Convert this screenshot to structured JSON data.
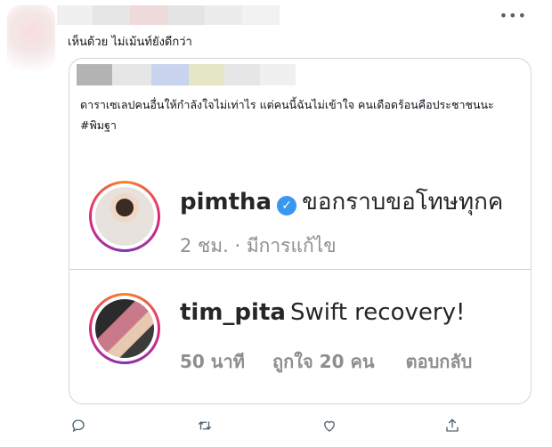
{
  "tweet": {
    "text": "เห็นด้วย ไม่เม้นท์ยังดีกว่า",
    "more_icon": "more-horizontal-icon",
    "redaction_colors": [
      "#f0f0f0",
      "#e6e6e6",
      "#eedada",
      "#e4e4e4",
      "#ececec",
      "#f2f2f2"
    ]
  },
  "quote": {
    "text": "ดาราเซเลปคนอื่นให้กำลังใจไม่เท่าไร แต่คนนี้ฉันไม่เข้าใจ คนเดือดร้อนคือประชาชนนะ #พิมฐา",
    "redaction_colors": [
      "#b3b3b3",
      "#e6e6e6",
      "#c8d4ee",
      "#e4e6c4",
      "#e6e6e6",
      "#f0f0f0"
    ]
  },
  "instagram": {
    "post": {
      "username": "pimtha",
      "caption": "ขอกราบขอโทษทุกค",
      "meta": "2 ชม. · มีการแก้ไข"
    },
    "comment": {
      "username": "tim_pita",
      "text": "Swift recovery!",
      "time": "50 นาที",
      "likes": "ถูกใจ 20 คน",
      "reply": "ตอบกลับ"
    }
  },
  "actions": {
    "reply_icon": "reply-icon",
    "retweet_icon": "retweet-icon",
    "like_icon": "heart-icon",
    "share_icon": "share-icon"
  }
}
